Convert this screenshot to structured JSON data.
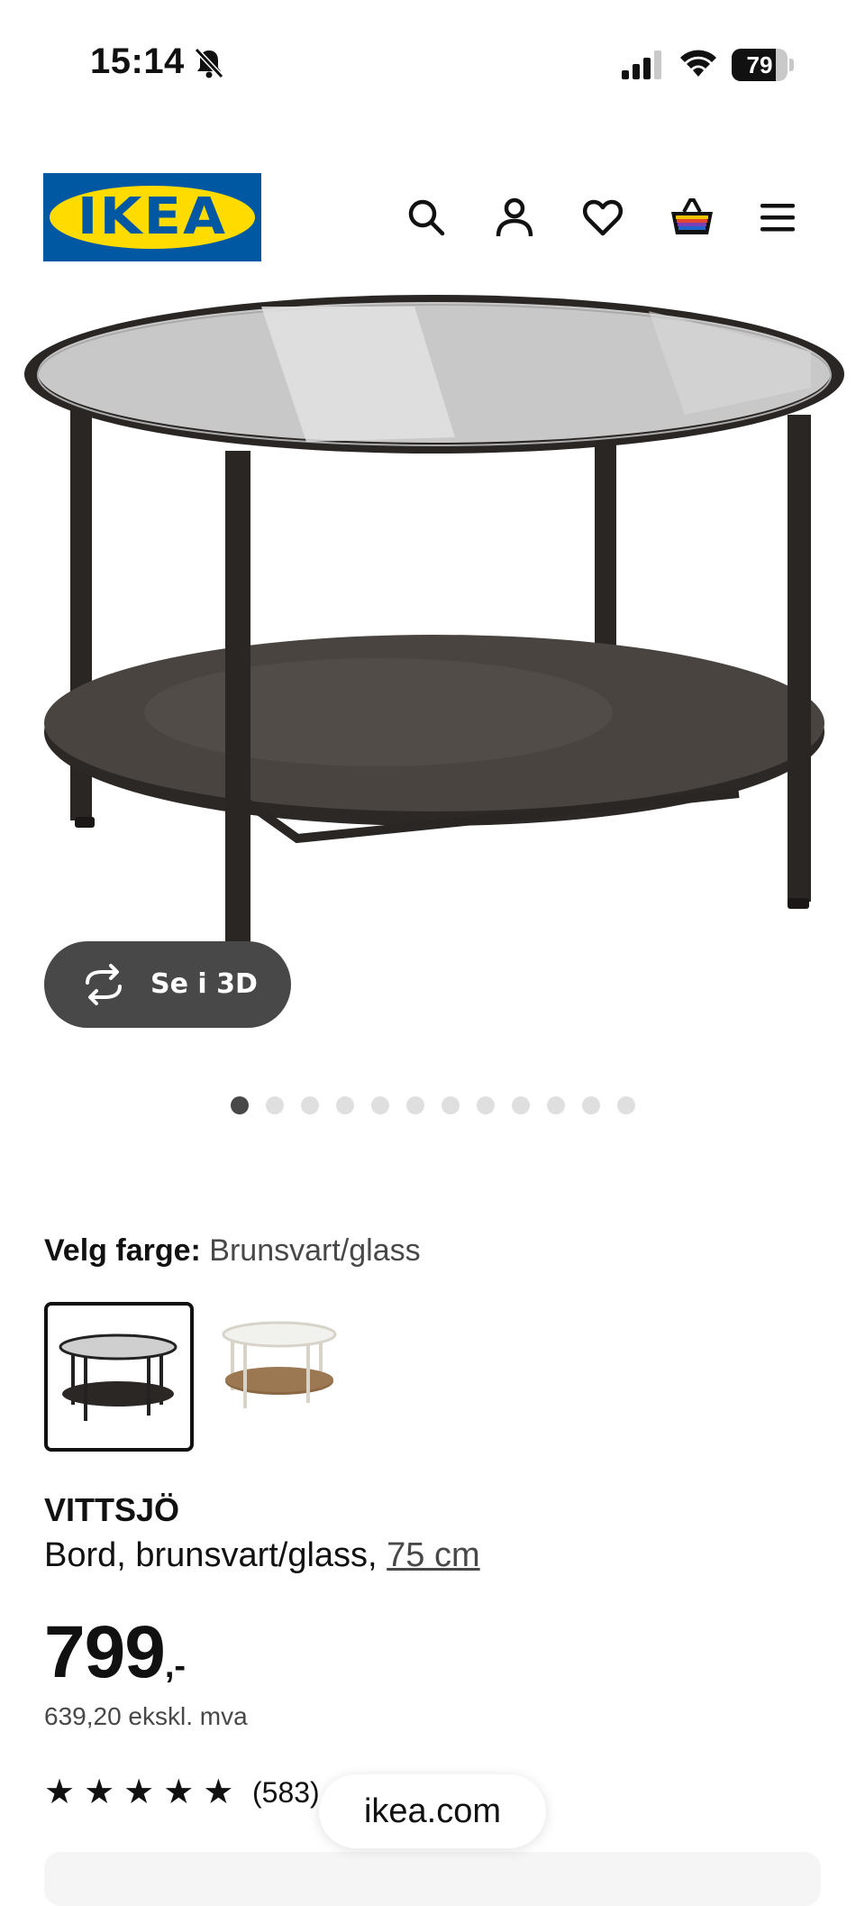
{
  "status": {
    "time": "15:14",
    "battery": "79",
    "battery_level": 0.79
  },
  "brand": {
    "logo_text": "IKEA",
    "colors": {
      "blue": "#0058a3",
      "yellow": "#ffdb00"
    }
  },
  "nav": {
    "icons": [
      "search-icon",
      "account-icon",
      "favourites-icon",
      "cart-icon",
      "menu-icon"
    ]
  },
  "gallery": {
    "view3d_label": "Se i 3D",
    "image_count": 12,
    "active_index": 0
  },
  "color_picker": {
    "label": "Velg farge:",
    "value": "Brunsvart/glass",
    "options": [
      {
        "name": "Brunsvart/glass",
        "selected": true
      },
      {
        "name": "hvit/glass",
        "selected": false
      }
    ]
  },
  "product": {
    "name": "VITTSJÖ",
    "description": "Bord, brunsvart/glass,",
    "size": "75 cm",
    "price_int": "799",
    "price_dec": ",-",
    "price_ex_vat": "639,20 ekskl. mva",
    "rating": 5,
    "review_count": "(583)"
  },
  "browser": {
    "url": "ikea.com"
  }
}
